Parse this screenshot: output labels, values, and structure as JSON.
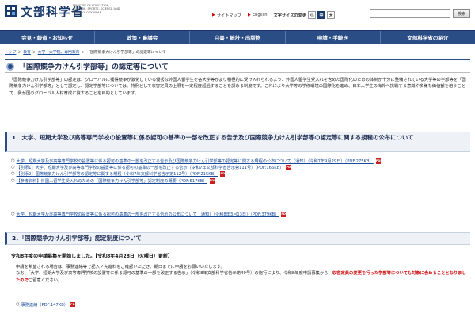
{
  "header": {
    "logo_text": "文部科学省",
    "logo_en": "MINISTRY OF EDUCATION, CULTURE, SPORTS, SCIENCE AND TECHNOLOGY-JAPAN",
    "site_map": "サイトマップ",
    "english": "English",
    "text_size_label": "文字サイズの変更",
    "text_sizes": [
      "小",
      "中",
      "大"
    ],
    "search_value": "",
    "search_button": "検索"
  },
  "nav": [
    "会見・報道・お知らせ",
    "政策・審議会",
    "白書・統計・出版物",
    "申請・手続き",
    "文部科学省の紹介"
  ],
  "breadcrumb": [
    "トップ",
    "教育",
    "大学・大学院、専門教育",
    "「国際競争力けん引学部等」の認定等について"
  ],
  "page_title": "「国際競争力けん引学部等」の認定等について",
  "intro": "「国際競争力けん引学部等」の認定は、グローバルに獲得競争が激化している優秀な外国人留学生を各大学等がより積極的に受け入れられるよう、外国人留学生受入れを含めた国際化のための体制が十分に整備されている大学等の学部等を「国際競争力けん引学部等」として認定し、認定学部等については、特例として収容定員の上限を一定程度超過することを認める制度です。これにより大学等の学修環境の国際化を進め、日本人学生の海外へ挑戦する意識や多様な価値観を培うことで、我が国のグローバル人材育成に資することを目的としています。",
  "section1_title": "1．大学、短期大学及び高等専門学校の設置等に係る認可の基準の一部を改正する告示及び国際競争力けん引学部等の認定等に関する規程の公布について",
  "section1_links": [
    {
      "bullet": "○",
      "text": "大学、短期大学及び高等専門学校の設置等に係る認可の基準の一部を改正する告示及び国際競争力けん引学部等の認定等に関する規程の公布について（通知）（令和7年9月29日）（PDF:275KB）",
      "pdf": true
    },
    {
      "bullet": "○",
      "text": "【別添1】大学、短期大学及び高等専門学校の設置等に係る認可の基準の一部を改正する告示（令和7年文部科学省告示第111号）（PDF:166KB）",
      "pdf": true
    },
    {
      "bullet": "○",
      "text": "【別添2】国際競争力けん引学部等の認定等に関する規程（令和7年文部科学省告示第112号）（PDF:215KB）",
      "pdf": true
    },
    {
      "bullet": "○",
      "text": "【参考資料】外国人留学生受入れのための「国際競争力けん引学部等」認定制度の概要（PDF:517KB）",
      "pdf": true
    }
  ],
  "section1b_links": [
    {
      "bullet": "○",
      "text": "大学、短期大学及び高等専門学校の設置等に係る認可の基準の一部を改正する告示の公布について（通知）（令和8年3月13日）（PDF:379KB）",
      "pdf": true
    }
  ],
  "section2_title": "2．「国際競争力けん引学部等」認定制度について",
  "notice_title": "令和8年度の申請募集を開始しました。【令和8年4月28日（火曜日）更新】",
  "notice_body_1": "申請を希望される場合は、事務連絡等で記入ノ先進料をご確認いただき、期日までに申請をお願いいたします。",
  "notice_body_2": "なお、「大学、短期大学及び高等専門学校の設置等に係る認可の基準の一部を改正する告示」（令和8年文部科学省告示第49号）の施行により、令和8年度申請募集から、",
  "notice_body_red": "収容定員の変更を行った学部等についても対象に含めることとなりましたので",
  "notice_body_3": "ご留意ください。",
  "notice_links": [
    {
      "bullet": "○",
      "text": "事務連絡（PDF:147KB）",
      "pdf": true
    }
  ]
}
